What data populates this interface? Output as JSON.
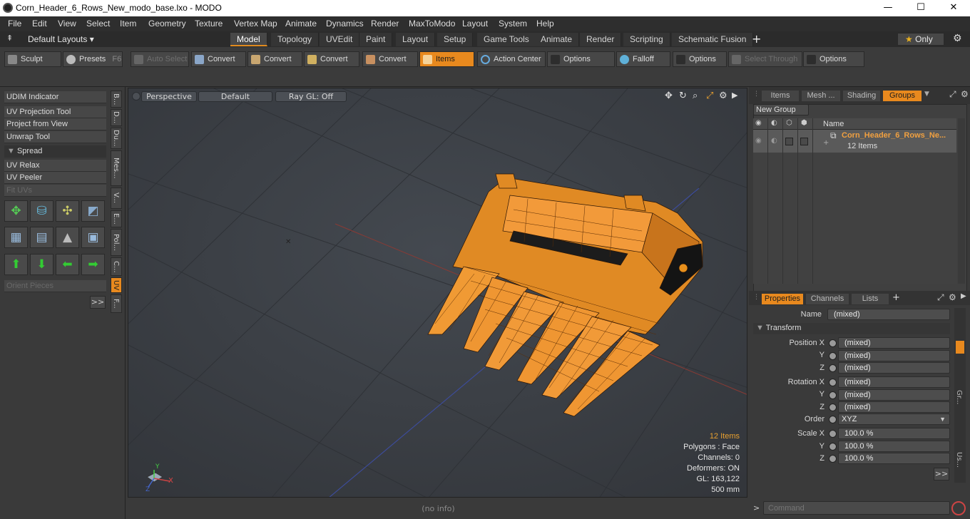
{
  "window": {
    "title": "Corn_Header_6_Rows_New_modo_base.lxo - MODO",
    "min": "—",
    "max": "☐",
    "close": "✕"
  },
  "menu": [
    "File",
    "Edit",
    "View",
    "Select",
    "Item",
    "Geometry",
    "Texture",
    "Vertex Map",
    "Animate",
    "Dynamics",
    "Render",
    "MaxToModo",
    "Layout",
    "System",
    "Help"
  ],
  "layout_selector": "Default Layouts",
  "tabs": [
    "Model",
    "Topology",
    "UVEdit",
    "Paint",
    "Layout",
    "Setup",
    "Game Tools",
    "Animate",
    "Render",
    "Scripting",
    "Schematic Fusion"
  ],
  "active_tab": "Model",
  "only_label": "Only",
  "toolbar": {
    "sculpt": "Sculpt",
    "presets": "Presets",
    "presets_key": "F6",
    "auto_select": "Auto Select",
    "convert1": "Convert",
    "convert2": "Convert",
    "convert3": "Convert",
    "convert4": "Convert",
    "items": "Items",
    "action_center": "Action Center",
    "options1": "Options",
    "falloff": "Falloff",
    "options2": "Options",
    "select_through": "Select Through",
    "options3": "Options"
  },
  "left_panel": {
    "udim": "UDIM Indicator",
    "uv_projection": "UV Projection Tool",
    "project_from_view": "Project from View",
    "unwrap": "Unwrap Tool",
    "spread": "Spread",
    "uv_relax": "UV Relax",
    "uv_peeler": "UV Peeler",
    "fit_uvs": "Fit UVs",
    "orient_pieces": "Orient Pieces",
    "more": ">>",
    "vtabs": [
      "B...",
      "D...",
      "Du...",
      "Mes...",
      "V...",
      "E...",
      "Pol...",
      "C...",
      "UV",
      "F..."
    ]
  },
  "viewport": {
    "perspective": "Perspective",
    "default": "Default",
    "raygl": "Ray GL: Off",
    "hud": {
      "items": "12 Items",
      "polygons": "Polygons : Face",
      "channels": "Channels: 0",
      "deformers": "Deformers: ON",
      "gl": "GL: 163,122",
      "size": "500 mm"
    },
    "axis_x": "X",
    "axis_y": "Y",
    "axis_z": "Z"
  },
  "status": "(no info)",
  "right_top": {
    "tabs": [
      "Items",
      "Mesh ...",
      "Shading",
      "Groups"
    ],
    "active": "Groups",
    "new_group": "New Group",
    "col_name": "Name",
    "group_name": "Corn_Header_6_Rows_Ne...",
    "group_count": "12 Items"
  },
  "properties": {
    "tabs": [
      "Properties",
      "Channels",
      "Lists"
    ],
    "name_label": "Name",
    "name_value": "(mixed)",
    "transform": "Transform",
    "position_x_label": "Position X",
    "y_label": "Y",
    "z_label": "Z",
    "rotation_x_label": "Rotation X",
    "order_label": "Order",
    "scale_x_label": "Scale X",
    "pos_x": "(mixed)",
    "pos_y": "(mixed)",
    "pos_z": "(mixed)",
    "rot_x": "(mixed)",
    "rot_y": "(mixed)",
    "rot_z": "(mixed)",
    "order": "XYZ",
    "scale_x": "100.0 %",
    "scale_y": "100.0 %",
    "scale_z": "100.0 %",
    "more": ">>",
    "side_tabs": [
      "Gr...",
      "Us..."
    ]
  },
  "command_placeholder": "Command",
  "colors": {
    "accent": "#e8891e",
    "model": "#f0902a"
  }
}
